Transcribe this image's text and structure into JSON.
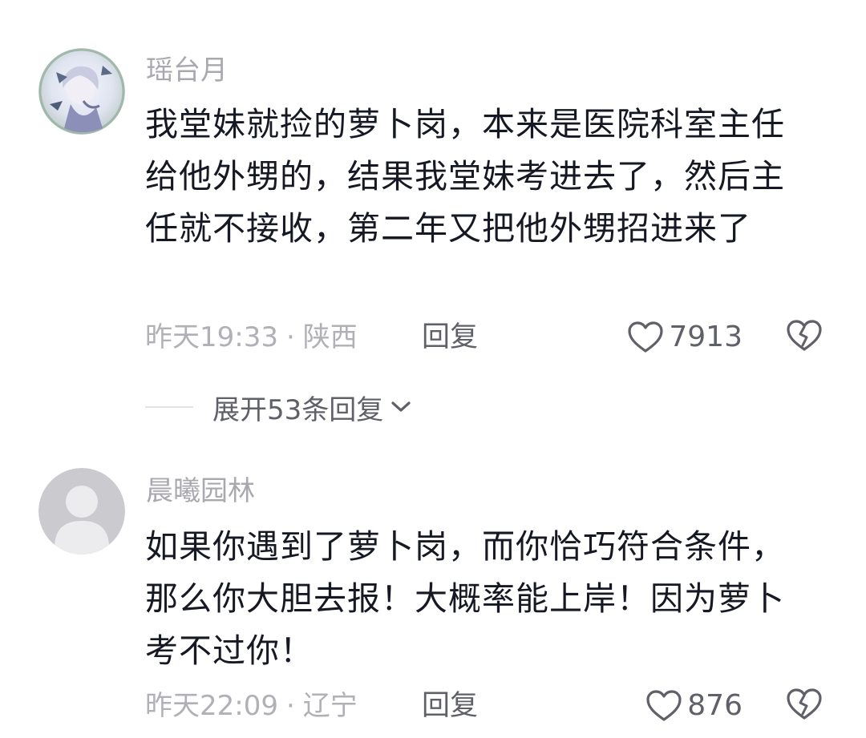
{
  "comments": [
    {
      "username": "瑶台月",
      "text": "我堂妹就捡的萝卜岗，本来是医院科室主任给他外甥的，结果我堂妹考进去了，然后主任就不接收，第二年又把他外甥招进来了",
      "time": "昨天19:33",
      "location": "陕西",
      "reply_label": "回复",
      "like_count": "7913",
      "expand_label": "展开53条回复"
    },
    {
      "username": "晨曦园林",
      "text": "如果你遇到了萝卜岗，而你恰巧符合条件，那么你大胆去报！大概率能上岸！因为萝卜考不过你！",
      "time": "昨天22:09",
      "location": "辽宁",
      "reply_label": "回复",
      "like_count": "876"
    }
  ],
  "icons": {
    "like": "heart-outline-icon",
    "dislike": "broken-heart-icon",
    "expand": "chevron-down-icon"
  },
  "colors": {
    "text_primary": "#161823",
    "text_secondary": "#a8a8ae",
    "action": "#5f6068",
    "background": "#ffffff"
  }
}
